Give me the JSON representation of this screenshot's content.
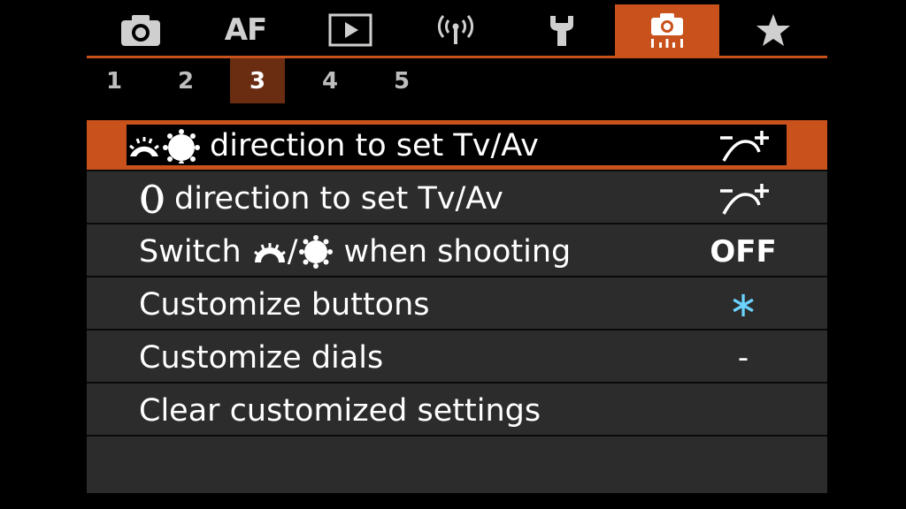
{
  "tabs": [
    {
      "id": "shooting",
      "icon": "camera-icon"
    },
    {
      "id": "af",
      "label": "AF"
    },
    {
      "id": "playback",
      "icon": "playback-icon"
    },
    {
      "id": "wireless",
      "icon": "wireless-icon"
    },
    {
      "id": "setup",
      "icon": "wrench-icon"
    },
    {
      "id": "custom",
      "icon": "custom-functions-icon",
      "active": true
    },
    {
      "id": "mymenu",
      "icon": "star-icon"
    }
  ],
  "subtabs": [
    "1",
    "2",
    "3",
    "4",
    "5"
  ],
  "active_subtab": "3",
  "menu": {
    "items": [
      {
        "label": "direction to set Tv/Av",
        "value_icon": "dial-direction-icon"
      },
      {
        "label": "direction to set Tv/Av",
        "value_icon": "dial-direction-icon"
      },
      {
        "label_pre": "Switch",
        "label_sep": "/",
        "label_post": "when shooting",
        "value": "OFF"
      },
      {
        "label": "Customize buttons",
        "value": "∗"
      },
      {
        "label": "Customize dials",
        "value": "-"
      },
      {
        "label": "Clear customized settings"
      }
    ]
  },
  "colors": {
    "accent": "#c8511c",
    "row_bg": "#2c2c2c",
    "asterisk": "#6ad3ff"
  }
}
